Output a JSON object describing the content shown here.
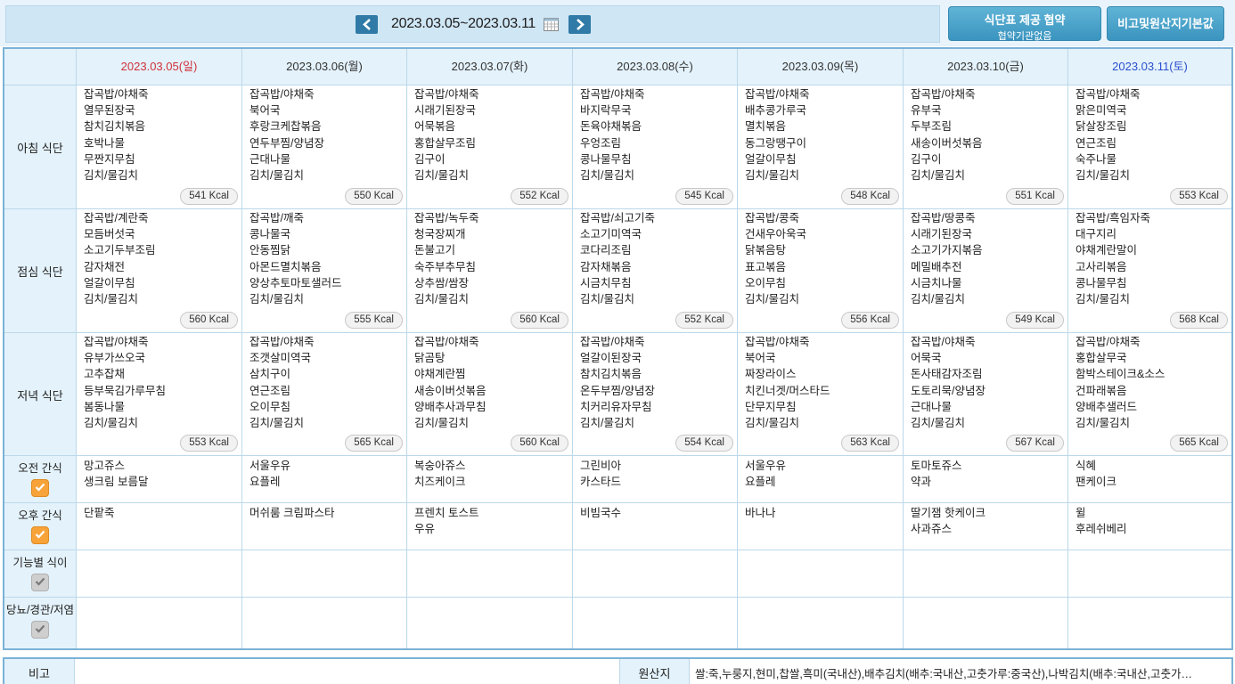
{
  "header": {
    "date_range": "2023.03.05~2023.03.11",
    "agreement_button": {
      "line1": "식단표 제공 협약",
      "line2": "협약기관없음"
    },
    "remarks_button": "비고및원산지기본값"
  },
  "days": [
    {
      "date": "2023.03.05(일)",
      "type": "sun"
    },
    {
      "date": "2023.03.06(월)",
      "type": "weekday"
    },
    {
      "date": "2023.03.07(화)",
      "type": "weekday"
    },
    {
      "date": "2023.03.08(수)",
      "type": "weekday"
    },
    {
      "date": "2023.03.09(목)",
      "type": "weekday"
    },
    {
      "date": "2023.03.10(금)",
      "type": "weekday"
    },
    {
      "date": "2023.03.11(토)",
      "type": "sat"
    }
  ],
  "meals": [
    {
      "label": "아침 식단",
      "cells": [
        {
          "items": [
            "잡곡밥/야채죽",
            "열무된장국",
            "참치김치볶음",
            "호박나물",
            "무짠지무침",
            "김치/물김치"
          ],
          "kcal": "541 Kcal"
        },
        {
          "items": [
            "잡곡밥/야채죽",
            "북어국",
            "후랑크케찹볶음",
            "연두부찜/양념장",
            "근대나물",
            "김치/물김치"
          ],
          "kcal": "550 Kcal"
        },
        {
          "items": [
            "잡곡밥/야채죽",
            "시래기된장국",
            "어묵볶음",
            "홍합살무조림",
            "김구이",
            "김치/물김치"
          ],
          "kcal": "552 Kcal"
        },
        {
          "items": [
            "잡곡밥/야채죽",
            "바지락무국",
            "돈육야채볶음",
            "우엉조림",
            "콩나물무침",
            "김치/물김치"
          ],
          "kcal": "545 Kcal"
        },
        {
          "items": [
            "잡곡밥/야채죽",
            "배추콩가루국",
            "멸치볶음",
            "동그랑땡구이",
            "얼갈이무침",
            "김치/물김치"
          ],
          "kcal": "548 Kcal"
        },
        {
          "items": [
            "잡곡밥/야채죽",
            "유부국",
            "두부조림",
            "새송이버섯볶음",
            "김구이",
            "김치/물김치"
          ],
          "kcal": "551 Kcal"
        },
        {
          "items": [
            "잡곡밥/야채죽",
            "맑은미역국",
            "닭살장조림",
            "연근조림",
            "숙주나물",
            "김치/물김치"
          ],
          "kcal": "553 Kcal"
        }
      ]
    },
    {
      "label": "점심 식단",
      "cells": [
        {
          "items": [
            "잡곡밥/계란죽",
            "모듬버섯국",
            "소고기두부조림",
            "감자채전",
            "얼갈이무침",
            "김치/물김치"
          ],
          "kcal": "560 Kcal"
        },
        {
          "items": [
            "잡곡밥/깨죽",
            "콩나물국",
            "안동찜닭",
            "아몬드멸치볶음",
            "양상추토마토샐러드",
            "김치/물김치"
          ],
          "kcal": "555 Kcal"
        },
        {
          "items": [
            "잡곡밥/녹두죽",
            "청국장찌개",
            "돈불고기",
            "숙주부추무침",
            "상추쌈/쌈장",
            "김치/물김치"
          ],
          "kcal": "560 Kcal"
        },
        {
          "items": [
            "잡곡밥/쇠고기죽",
            "소고기미역국",
            "코다리조림",
            "감자채볶음",
            "시금치무침",
            "김치/물김치"
          ],
          "kcal": "552 Kcal"
        },
        {
          "items": [
            "잡곡밥/콩죽",
            "건새우아욱국",
            "닭볶음탕",
            "표고볶음",
            "오이무침",
            "김치/물김치"
          ],
          "kcal": "556 Kcal"
        },
        {
          "items": [
            "잡곡밥/땅콩죽",
            "시래기된장국",
            "소고기가지볶음",
            "메밀배추전",
            "시금치나물",
            "김치/물김치"
          ],
          "kcal": "549 Kcal"
        },
        {
          "items": [
            "잡곡밥/흑임자죽",
            "대구지리",
            "야채계란말이",
            "고사리볶음",
            "콩나물무침",
            "김치/물김치"
          ],
          "kcal": "568 Kcal"
        }
      ]
    },
    {
      "label": "저녁 식단",
      "cells": [
        {
          "items": [
            "잡곡밥/야채죽",
            "유부가쓰오국",
            "고추잡채",
            "등부묵김가루무침",
            "봄동나물",
            "김치/물김치"
          ],
          "kcal": "553 Kcal"
        },
        {
          "items": [
            "잡곡밥/야채죽",
            "조갯살미역국",
            "삼치구이",
            "연근조림",
            "오이무침",
            "김치/물김치"
          ],
          "kcal": "565 Kcal"
        },
        {
          "items": [
            "잡곡밥/야채죽",
            "닭곰탕",
            "야채계란찜",
            "새송이버섯볶음",
            "양배추사과무침",
            "김치/물김치"
          ],
          "kcal": "560 Kcal"
        },
        {
          "items": [
            "잡곡밥/야채죽",
            "얼갈이된장국",
            "참치김치볶음",
            "온두부찜/양념장",
            "치커리유자무침",
            "김치/물김치"
          ],
          "kcal": "554 Kcal"
        },
        {
          "items": [
            "잡곡밥/야채죽",
            "북어국",
            "짜장라이스",
            "치킨너겟/머스타드",
            "단무지무침",
            "김치/물김치"
          ],
          "kcal": "563 Kcal"
        },
        {
          "items": [
            "잡곡밥/야채죽",
            "어묵국",
            "돈사태감자조림",
            "도토리묵/양념장",
            "근대나물",
            "김치/물김치"
          ],
          "kcal": "567 Kcal"
        },
        {
          "items": [
            "잡곡밥/야채죽",
            "홍합살무국",
            "함박스테이크&소스",
            "건파래볶음",
            "양배추샐러드",
            "김치/물김치"
          ],
          "kcal": "565 Kcal"
        }
      ]
    }
  ],
  "extras": [
    {
      "label": "오전 간식",
      "checked": true,
      "cells": [
        [
          "망고쥬스",
          "생크림 보름달"
        ],
        [
          "서울우유",
          "요플레"
        ],
        [
          "복숭아쥬스",
          "치즈케이크"
        ],
        [
          "그린비아",
          "카스타드"
        ],
        [
          "서울우유",
          "요플레"
        ],
        [
          "토마토쥬스",
          "약과"
        ],
        [
          "식혜",
          "팬케이크"
        ]
      ]
    },
    {
      "label": "오후 간식",
      "checked": true,
      "cells": [
        [
          "단팥죽"
        ],
        [
          "머쉬룸 크림파스타"
        ],
        [
          "프렌치 토스트",
          "우유"
        ],
        [
          "비빔국수"
        ],
        [
          "바나나"
        ],
        [
          "딸기잼 핫케이크",
          "사과쥬스"
        ],
        [
          "윌",
          "후레쉬베리"
        ]
      ]
    },
    {
      "label": "기능별 식이",
      "checked": false,
      "cells": [
        [],
        [],
        [],
        [],
        [],
        [],
        []
      ]
    },
    {
      "label": "당뇨/경관/저염",
      "checked": false,
      "cells": [
        [],
        [],
        [],
        [],
        [],
        [],
        []
      ]
    }
  ],
  "footer": {
    "remarks_label": "비고",
    "origin_label": "원산지",
    "origin_text": "쌀:죽,누룽지,현미,찹쌀,흑미(국내산),배추김치(배추:국내산,고춧가루:중국산),나박김치(배추:국내산,고춧가…"
  },
  "colors": {
    "accent": "#2f7aa6",
    "border": "#7ab2d6",
    "label_bg": "#e4f2fb",
    "sunday": "#d0313a",
    "saturday": "#2b4fcf",
    "check_on": "#f7a33a"
  }
}
